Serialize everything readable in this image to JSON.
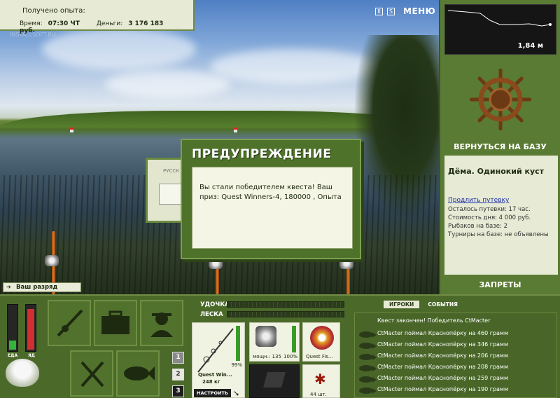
{
  "info": {
    "exp_label": "Получено опыта:",
    "time_label": "Время:",
    "time_value": "07:30 ЧТ",
    "money_label": "Деньги:",
    "money_value": "3 176 183 руб."
  },
  "watermark": "INSTALLSOFT.RU",
  "topbar": {
    "pause_glyph": "II",
    "sound_glyph": "S",
    "menu_label": "МЕНЮ"
  },
  "depth": {
    "value": "1,84 м"
  },
  "right_panel": {
    "back_label": "ВЕРНУТЬСЯ НА БАЗУ",
    "location": "Дёма. Одинокий куст",
    "extend_link": "Продлить путевку",
    "lines": [
      "Осталось путевки: 17 час.",
      "Стоимость дня: 4 000 руб.",
      "Рыбаков на базе: 2",
      "Турниры на базе: не объявлены"
    ],
    "bans_label": "ЗАПРЕТЫ"
  },
  "rank_message": "Ваш разряд вырос!",
  "dialog": {
    "title": "ПРЕДУПРЕЖДЕНИЕ",
    "text": "Вы стали победителем квеста! Ваш приз: Quest Winners-4, 180000 , Опыта",
    "bg_window_label": "РУССК"
  },
  "gauges": {
    "food_label": "ЕДА",
    "poison_label": "ЯД",
    "food_level": 0.2,
    "poison_level": 0.9
  },
  "tiles": {
    "page_numbers": [
      "1",
      "2",
      "3"
    ]
  },
  "tackle": {
    "rod_label": "УДОЧКА",
    "line_label": "ЛЕСКА",
    "rod_name": "Quest Win...",
    "rod_weight": "248 кг",
    "rod_percent": "99%",
    "reel_caption": "мощн.: 135",
    "reel_percent": "100%",
    "line_caption": "Quest Fis...",
    "bait_caption": "44 шт.",
    "tune_label": "НАСТРОИТЬ"
  },
  "events": {
    "tabs": [
      "ИГРОКИ",
      "СОБЫТИЯ"
    ],
    "items": [
      "Квест закончен! Победитель CtMacter",
      "CtMacter поймал Краснопёрку на 460 грамм",
      "CtMacter поймал Краснопёрку на 346 грамм",
      "CtMacter поймал Краснопёрку на 206 грамм",
      "CtMacter поймал Краснопёрку на 208 грамм",
      "CtMacter поймал Краснопёрку на 259 грамм",
      "CtMacter поймал Краснопёрку на 190 грамм"
    ]
  }
}
